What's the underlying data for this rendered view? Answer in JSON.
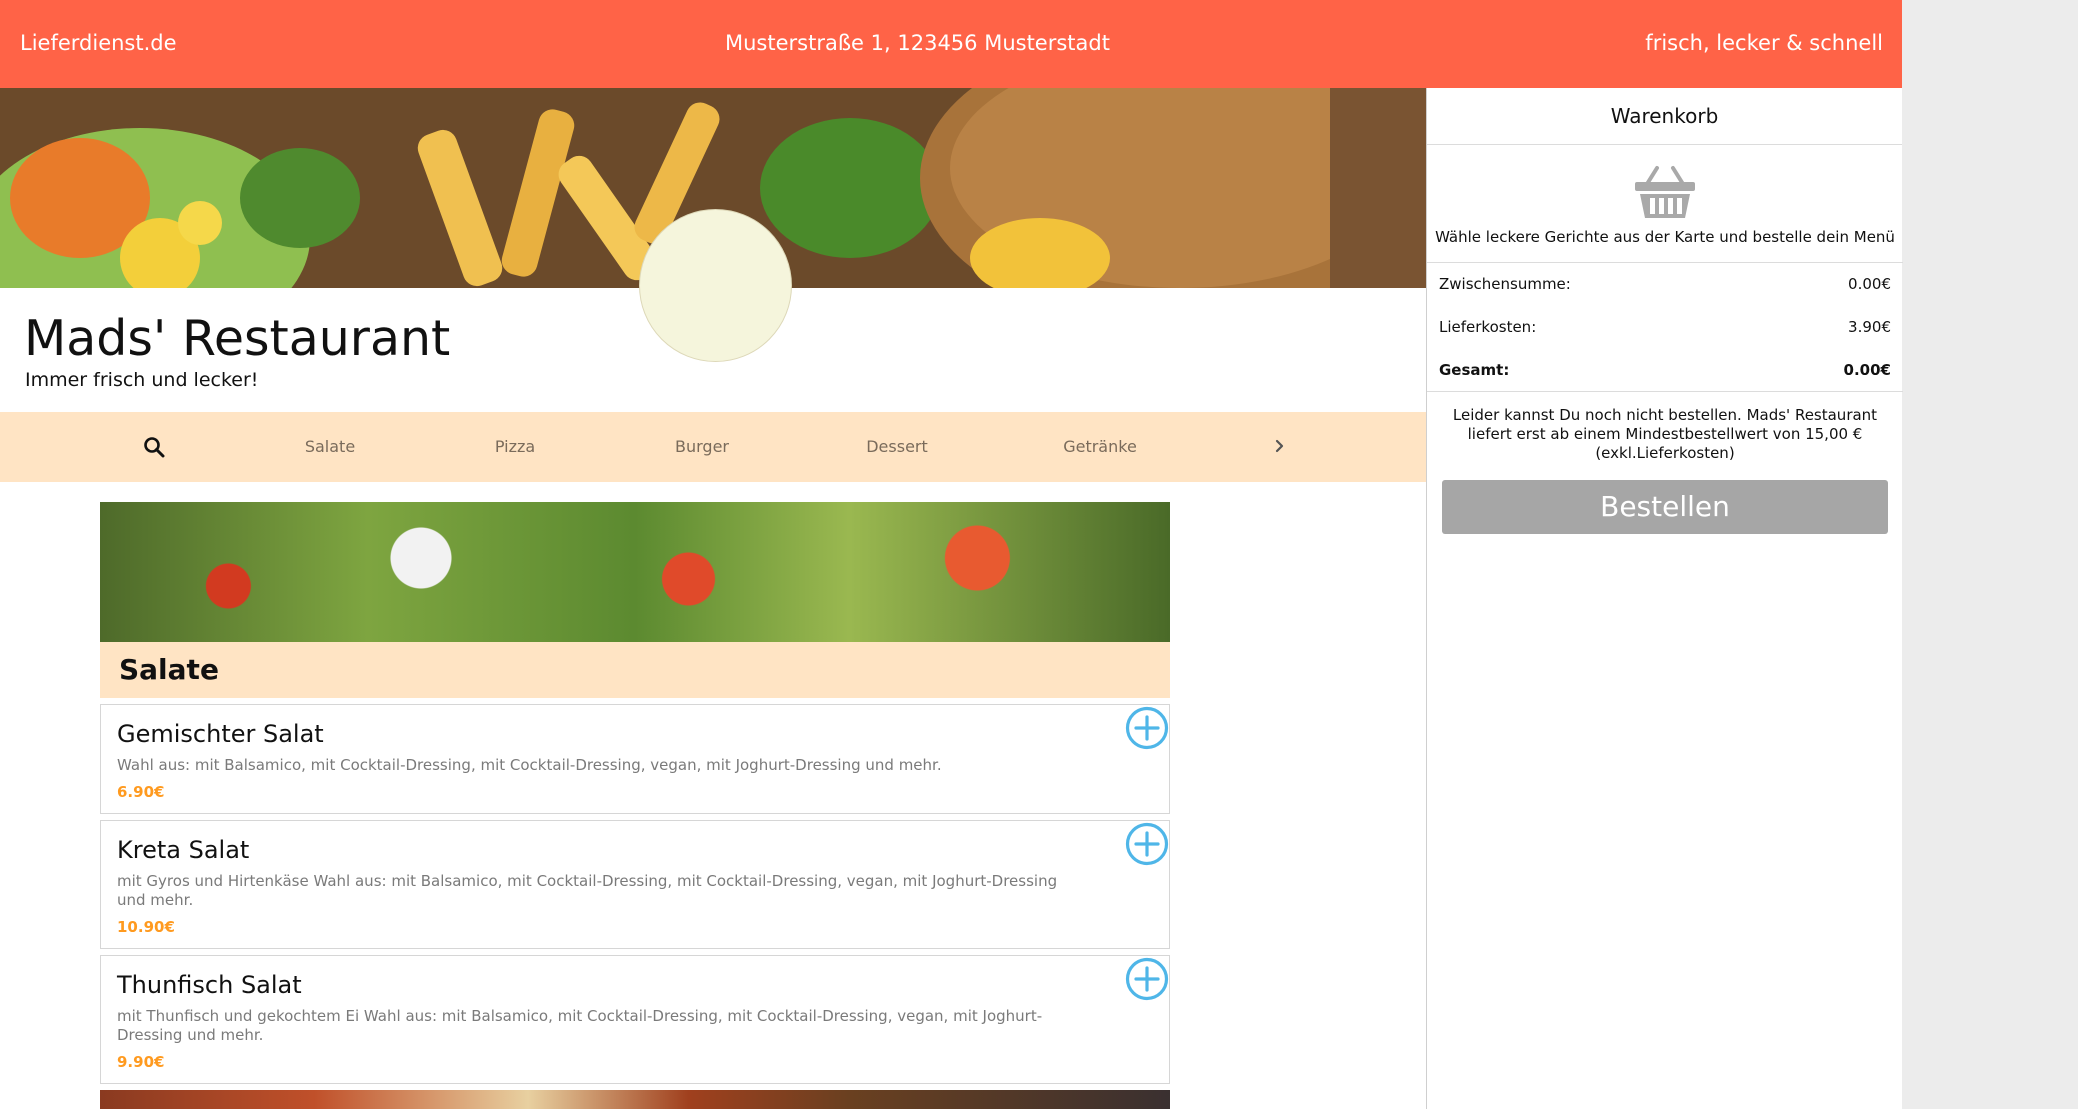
{
  "topbar": {
    "brand": "Lieferdienst.de",
    "address": "Musterstraße 1, 123456 Musterstadt",
    "slogan": "frisch, lecker & schnell"
  },
  "restaurant": {
    "name": "Mads' Restaurant",
    "tagline": "Immer frisch und lecker!"
  },
  "category_nav": {
    "search_icon": "search-icon",
    "items": [
      "Salate",
      "Pizza",
      "Burger",
      "Dessert",
      "Getränke"
    ],
    "next_icon": "chevron-right-icon"
  },
  "menu": {
    "category_title": "Salate",
    "dishes": [
      {
        "name": "Gemischter Salat",
        "description": "Wahl aus: mit Balsamico, mit Cocktail-Dressing, mit Cocktail-Dressing, vegan, mit Joghurt-Dressing und mehr.",
        "price": "6.90€"
      },
      {
        "name": "Kreta Salat",
        "description": "mit Gyros und Hirtenkäse Wahl aus: mit Balsamico, mit Cocktail-Dressing, mit Cocktail-Dressing, vegan, mit Joghurt-Dressing und mehr.",
        "price": "10.90€"
      },
      {
        "name": "Thunfisch Salat",
        "description": "mit Thunfisch und gekochtem Ei Wahl aus: mit Balsamico, mit Cocktail-Dressing, mit Cocktail-Dressing, vegan, mit Joghurt-Dressing und mehr.",
        "price": "9.90€"
      }
    ],
    "add_icon": "plus-circle-icon"
  },
  "cart": {
    "title": "Warenkorb",
    "basket_icon": "basket-icon",
    "empty_text": "Wähle leckere Gerichte aus der Karte und bestelle dein Menü",
    "subtotal_label": "Zwischensumme:",
    "subtotal_value": "0.00€",
    "delivery_label": "Lieferkosten:",
    "delivery_value": "3.90€",
    "total_label": "Gesamt:",
    "total_value": "0.00€",
    "notice": "Leider kannst Du noch nicht bestellen. Mads' Restaurant liefert erst ab einem Mindestbestellwert von 15,00 € (exkl.Lieferkosten)",
    "order_button": "Bestellen"
  },
  "colors": {
    "topbar": "#ff6347",
    "nav_bg": "#ffe4c4",
    "price": "#ff9a1f",
    "add_icon": "#4fb6e8",
    "order_button": "#a6a6a6"
  }
}
